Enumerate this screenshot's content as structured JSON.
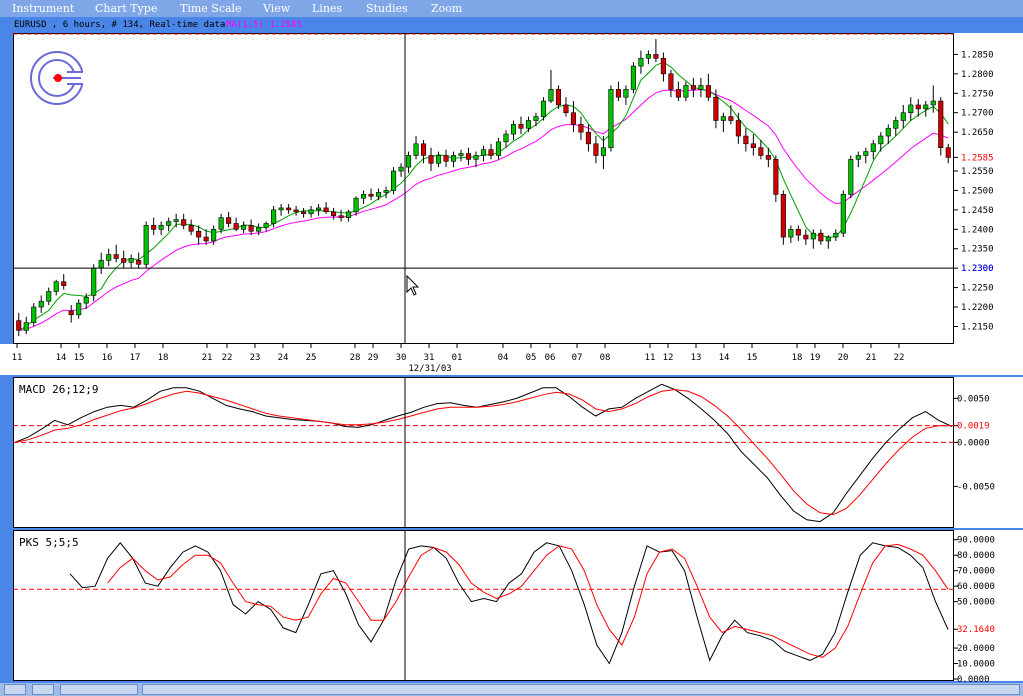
{
  "menu": [
    "Instrument",
    "Chart Type",
    "Time Scale",
    "View",
    "Lines",
    "Studies",
    "Zoom"
  ],
  "header": {
    "symbol_info": "EURUSD , 6 hours, # 134, Real-time data",
    "ma_info": "MA(1;5) 1.2585"
  },
  "crosshair_date": "12/31/03",
  "main_panel": {
    "price_ticks": [
      "1.2850",
      "1.2800",
      "1.2750",
      "1.2700",
      "1.2650",
      "1.2585",
      "1.2550",
      "1.2500",
      "1.2450",
      "1.2400",
      "1.2350",
      "1.2300",
      "1.2250",
      "1.2200",
      "1.2150"
    ],
    "current_price": "1.2585",
    "current_price_color": "#ff0000",
    "crosshair_price": "1.2300",
    "crosshair_price_color": "#0000ff",
    "date_ticks": [
      "11",
      "14",
      "15",
      "16",
      "17",
      "18",
      "21",
      "22",
      "23",
      "24",
      "25",
      "28",
      "29",
      "30",
      "31",
      "01",
      "04",
      "05",
      "06",
      "07",
      "08",
      "11",
      "12",
      "13",
      "14",
      "15",
      "18",
      "19",
      "20",
      "21",
      "22"
    ]
  },
  "macd_panel": {
    "title": "MACD 26;12;9",
    "ticks": [
      "0.0050",
      "0.0019",
      "0.0000",
      "-0.0050"
    ],
    "highlight_color": "#ff0000"
  },
  "pks_panel": {
    "title": "PKS 5;5;5",
    "ticks": [
      "90.0000",
      "80.0000",
      "70.0000",
      "60.0000",
      "50.0000",
      "32.1640",
      "20.0000",
      "10.0000",
      "0.0000"
    ],
    "highlight_color": "#ff0000"
  },
  "chart_data": [
    {
      "type": "candlestick",
      "title": "EURUSD , 6 hours, # 134, Real-time data",
      "ylim": [
        1.211,
        1.29
      ],
      "ohlc": [
        [
          1.2165,
          1.2185,
          1.2125,
          1.214
        ],
        [
          1.214,
          1.2175,
          1.213,
          1.216
        ],
        [
          1.216,
          1.221,
          1.215,
          1.22
        ],
        [
          1.22,
          1.223,
          1.2185,
          1.2215
        ],
        [
          1.2215,
          1.225,
          1.2205,
          1.224
        ],
        [
          1.224,
          1.227,
          1.223,
          1.2265
        ],
        [
          1.2265,
          1.2285,
          1.2245,
          1.2255
        ],
        [
          1.219,
          1.2205,
          1.216,
          1.218
        ],
        [
          1.218,
          1.222,
          1.217,
          1.221
        ],
        [
          1.221,
          1.2235,
          1.2195,
          1.2225
        ],
        [
          1.223,
          1.231,
          1.2215,
          1.23
        ],
        [
          1.23,
          1.234,
          1.2285,
          1.232
        ],
        [
          1.232,
          1.235,
          1.2305,
          1.2335
        ],
        [
          1.2335,
          1.236,
          1.2315,
          1.2325
        ],
        [
          1.2325,
          1.2345,
          1.23,
          1.2315
        ],
        [
          1.2315,
          1.2335,
          1.23,
          1.2325
        ],
        [
          1.232,
          1.234,
          1.23,
          1.231
        ],
        [
          1.231,
          1.242,
          1.23,
          1.241
        ],
        [
          1.241,
          1.243,
          1.2385,
          1.24
        ],
        [
          1.24,
          1.242,
          1.2385,
          1.241
        ],
        [
          1.241,
          1.243,
          1.2395,
          1.242
        ],
        [
          1.242,
          1.244,
          1.2405,
          1.2425
        ],
        [
          1.2425,
          1.244,
          1.24,
          1.241
        ],
        [
          1.241,
          1.2425,
          1.2385,
          1.2395
        ],
        [
          1.2395,
          1.241,
          1.236,
          1.238
        ],
        [
          1.238,
          1.24,
          1.236,
          1.237
        ],
        [
          1.237,
          1.241,
          1.236,
          1.24
        ],
        [
          1.24,
          1.244,
          1.239,
          1.243
        ],
        [
          1.243,
          1.2445,
          1.2405,
          1.2415
        ],
        [
          1.2415,
          1.243,
          1.2395,
          1.24
        ],
        [
          1.24,
          1.242,
          1.239,
          1.241
        ],
        [
          1.241,
          1.2425,
          1.2385,
          1.2395
        ],
        [
          1.2395,
          1.2415,
          1.2385,
          1.2405
        ],
        [
          1.2405,
          1.242,
          1.2395,
          1.2415
        ],
        [
          1.2415,
          1.246,
          1.2405,
          1.245
        ],
        [
          1.245,
          1.2465,
          1.2435,
          1.2455
        ],
        [
          1.2455,
          1.2465,
          1.244,
          1.245
        ],
        [
          1.245,
          1.246,
          1.2435,
          1.2445
        ],
        [
          1.2445,
          1.2455,
          1.243,
          1.244
        ],
        [
          1.244,
          1.246,
          1.243,
          1.245
        ],
        [
          1.245,
          1.2465,
          1.2435,
          1.2455
        ],
        [
          1.2455,
          1.247,
          1.244,
          1.2445
        ],
        [
          1.2445,
          1.2455,
          1.2425,
          1.2435
        ],
        [
          1.2435,
          1.245,
          1.242,
          1.243
        ],
        [
          1.243,
          1.245,
          1.242,
          1.2445
        ],
        [
          1.2445,
          1.2485,
          1.2435,
          1.248
        ],
        [
          1.248,
          1.25,
          1.2465,
          1.249
        ],
        [
          1.249,
          1.2505,
          1.2475,
          1.2485
        ],
        [
          1.2485,
          1.2505,
          1.2475,
          1.2495
        ],
        [
          1.2495,
          1.251,
          1.248,
          1.25
        ],
        [
          1.25,
          1.256,
          1.249,
          1.255
        ],
        [
          1.255,
          1.257,
          1.2535,
          1.256
        ],
        [
          1.256,
          1.26,
          1.2545,
          1.259
        ],
        [
          1.259,
          1.264,
          1.258,
          1.262
        ],
        [
          1.262,
          1.263,
          1.257,
          1.259
        ],
        [
          1.259,
          1.261,
          1.255,
          1.257
        ],
        [
          1.257,
          1.26,
          1.256,
          1.259
        ],
        [
          1.259,
          1.2605,
          1.256,
          1.2575
        ],
        [
          1.2575,
          1.26,
          1.256,
          1.259
        ],
        [
          1.259,
          1.2605,
          1.2575,
          1.2595
        ],
        [
          1.2595,
          1.261,
          1.2565,
          1.258
        ],
        [
          1.258,
          1.26,
          1.256,
          1.259
        ],
        [
          1.259,
          1.2615,
          1.2575,
          1.2605
        ],
        [
          1.2605,
          1.262,
          1.258,
          1.259
        ],
        [
          1.259,
          1.2635,
          1.258,
          1.2625
        ],
        [
          1.2625,
          1.2655,
          1.261,
          1.2645
        ],
        [
          1.2645,
          1.268,
          1.263,
          1.267
        ],
        [
          1.267,
          1.269,
          1.2645,
          1.266
        ],
        [
          1.266,
          1.269,
          1.265,
          1.268
        ],
        [
          1.268,
          1.27,
          1.2665,
          1.269
        ],
        [
          1.269,
          1.274,
          1.268,
          1.273
        ],
        [
          1.273,
          1.281,
          1.2725,
          1.276
        ],
        [
          1.276,
          1.277,
          1.271,
          1.272
        ],
        [
          1.272,
          1.274,
          1.269,
          1.27
        ],
        [
          1.27,
          1.273,
          1.265,
          1.267
        ],
        [
          1.267,
          1.269,
          1.263,
          1.265
        ],
        [
          1.265,
          1.267,
          1.26,
          1.262
        ],
        [
          1.262,
          1.264,
          1.257,
          1.259
        ],
        [
          1.259,
          1.264,
          1.2555,
          1.261
        ],
        [
          1.261,
          1.277,
          1.26,
          1.276
        ],
        [
          1.276,
          1.278,
          1.273,
          1.274
        ],
        [
          1.274,
          1.277,
          1.272,
          1.276
        ],
        [
          1.276,
          1.283,
          1.275,
          1.282
        ],
        [
          1.282,
          1.286,
          1.28,
          1.284
        ],
        [
          1.284,
          1.286,
          1.2825,
          1.285
        ],
        [
          1.285,
          1.289,
          1.283,
          1.284
        ],
        [
          1.284,
          1.2855,
          1.278,
          1.28
        ],
        [
          1.28,
          1.281,
          1.274,
          1.276
        ],
        [
          1.276,
          1.278,
          1.273,
          1.274
        ],
        [
          1.274,
          1.278,
          1.273,
          1.277
        ],
        [
          1.277,
          1.279,
          1.274,
          1.276
        ],
        [
          1.276,
          1.279,
          1.274,
          1.277
        ],
        [
          1.277,
          1.28,
          1.273,
          1.274
        ],
        [
          1.274,
          1.276,
          1.266,
          1.268
        ],
        [
          1.268,
          1.27,
          1.265,
          1.269
        ],
        [
          1.269,
          1.272,
          1.267,
          1.268
        ],
        [
          1.268,
          1.27,
          1.262,
          1.264
        ],
        [
          1.264,
          1.266,
          1.26,
          1.262
        ],
        [
          1.262,
          1.2645,
          1.259,
          1.261
        ],
        [
          1.261,
          1.263,
          1.258,
          1.259
        ],
        [
          1.259,
          1.261,
          1.256,
          1.258
        ],
        [
          1.258,
          1.259,
          1.247,
          1.249
        ],
        [
          1.249,
          1.25,
          1.236,
          1.238
        ],
        [
          1.238,
          1.241,
          1.2365,
          1.24
        ],
        [
          1.24,
          1.241,
          1.237,
          1.2385
        ],
        [
          1.2385,
          1.24,
          1.236,
          1.2375
        ],
        [
          1.2375,
          1.24,
          1.235,
          1.239
        ],
        [
          1.239,
          1.24,
          1.236,
          1.237
        ],
        [
          1.237,
          1.2385,
          1.235,
          1.238
        ],
        [
          1.238,
          1.24,
          1.237,
          1.239
        ],
        [
          1.239,
          1.25,
          1.238,
          1.249
        ],
        [
          1.249,
          1.259,
          1.248,
          1.258
        ],
        [
          1.258,
          1.26,
          1.256,
          1.259
        ],
        [
          1.259,
          1.261,
          1.257,
          1.26
        ],
        [
          1.26,
          1.263,
          1.258,
          1.262
        ],
        [
          1.262,
          1.265,
          1.26,
          1.264
        ],
        [
          1.264,
          1.267,
          1.262,
          1.266
        ],
        [
          1.266,
          1.269,
          1.264,
          1.268
        ],
        [
          1.268,
          1.272,
          1.266,
          1.27
        ],
        [
          1.27,
          1.274,
          1.268,
          1.272
        ],
        [
          1.272,
          1.2735,
          1.269,
          1.271
        ],
        [
          1.271,
          1.273,
          1.269,
          1.272
        ],
        [
          1.272,
          1.277,
          1.27,
          1.273
        ],
        [
          1.273,
          1.274,
          1.259,
          1.261
        ],
        [
          1.261,
          1.262,
          1.257,
          1.2585
        ]
      ]
    },
    {
      "type": "line",
      "title": "MACD 26;12;9",
      "ylim": [
        -0.0095,
        0.0072
      ],
      "series": [
        {
          "color": "#000000",
          "values": [
            0.0,
            0.0006,
            0.0015,
            0.0025,
            0.002,
            0.0028,
            0.0035,
            0.004,
            0.0042,
            0.004,
            0.0048,
            0.0058,
            0.0062,
            0.0062,
            0.0058,
            0.005,
            0.0042,
            0.0038,
            0.0035,
            0.003,
            0.0028,
            0.0026,
            0.0025,
            0.0024,
            0.0022,
            0.0018,
            0.0017,
            0.002,
            0.0025,
            0.003,
            0.0034,
            0.004,
            0.0044,
            0.0045,
            0.0042,
            0.004,
            0.0043,
            0.0046,
            0.005,
            0.0056,
            0.0062,
            0.0062,
            0.0052,
            0.004,
            0.003,
            0.0038,
            0.004,
            0.005,
            0.0058,
            0.0066,
            0.006,
            0.005,
            0.0038,
            0.0025,
            0.001,
            -0.001,
            -0.0025,
            -0.004,
            -0.006,
            -0.0078,
            -0.0088,
            -0.009,
            -0.008,
            -0.0058,
            -0.0038,
            -0.0018,
            0.0,
            0.0015,
            0.0028,
            0.0035,
            0.0025,
            0.0018
          ]
        },
        {
          "color": "#ff0000",
          "values": [
            0.0,
            0.0003,
            0.0008,
            0.0014,
            0.0016,
            0.002,
            0.0026,
            0.0031,
            0.0036,
            0.0039,
            0.0044,
            0.005,
            0.0055,
            0.0058,
            0.0056,
            0.0052,
            0.0048,
            0.0043,
            0.0038,
            0.0033,
            0.003,
            0.0028,
            0.0026,
            0.0024,
            0.0022,
            0.002,
            0.002,
            0.0021,
            0.0023,
            0.0026,
            0.003,
            0.0034,
            0.0038,
            0.004,
            0.004,
            0.004,
            0.0041,
            0.0043,
            0.0046,
            0.005,
            0.0054,
            0.0057,
            0.0055,
            0.0048,
            0.0038,
            0.0035,
            0.0038,
            0.0044,
            0.0052,
            0.0058,
            0.006,
            0.0058,
            0.0052,
            0.0042,
            0.003,
            0.0015,
            -0.0002,
            -0.0018,
            -0.0036,
            -0.0055,
            -0.007,
            -0.008,
            -0.0082,
            -0.0075,
            -0.006,
            -0.0042,
            -0.0024,
            -0.0008,
            0.0006,
            0.0016,
            0.0019,
            0.0019
          ]
        }
      ],
      "hlines": [
        0.0019,
        0.0
      ]
    },
    {
      "type": "line",
      "title": "PKS 5;5;5",
      "ylim": [
        0,
        95
      ],
      "series": [
        {
          "color": "#000000",
          "values": [
            68,
            59,
            60,
            78,
            88,
            78,
            62,
            60,
            72,
            82,
            86,
            82,
            70,
            48,
            42,
            50,
            45,
            33,
            30,
            48,
            68,
            70,
            55,
            35,
            24,
            38,
            64,
            84,
            86,
            85,
            78,
            62,
            50,
            52,
            50,
            62,
            68,
            82,
            88,
            86,
            70,
            48,
            22,
            10,
            30,
            60,
            86,
            82,
            83,
            70,
            40,
            12,
            28,
            38,
            30,
            28,
            25,
            18,
            15,
            12,
            16,
            30,
            56,
            80,
            88,
            86,
            85,
            80,
            72,
            50,
            32
          ]
        },
        {
          "color": "#ff0000",
          "values": [
            null,
            null,
            null,
            62,
            72,
            78,
            70,
            64,
            66,
            74,
            80,
            80,
            75,
            62,
            50,
            48,
            47,
            40,
            38,
            40,
            55,
            65,
            62,
            50,
            38,
            38,
            50,
            66,
            80,
            85,
            82,
            74,
            62,
            56,
            52,
            55,
            60,
            70,
            80,
            86,
            84,
            70,
            48,
            32,
            22,
            40,
            68,
            82,
            84,
            78,
            60,
            40,
            30,
            34,
            32,
            30,
            28,
            24,
            20,
            16,
            14,
            20,
            34,
            55,
            75,
            86,
            87,
            84,
            80,
            70,
            58
          ]
        }
      ],
      "hlines": [
        58
      ]
    }
  ]
}
